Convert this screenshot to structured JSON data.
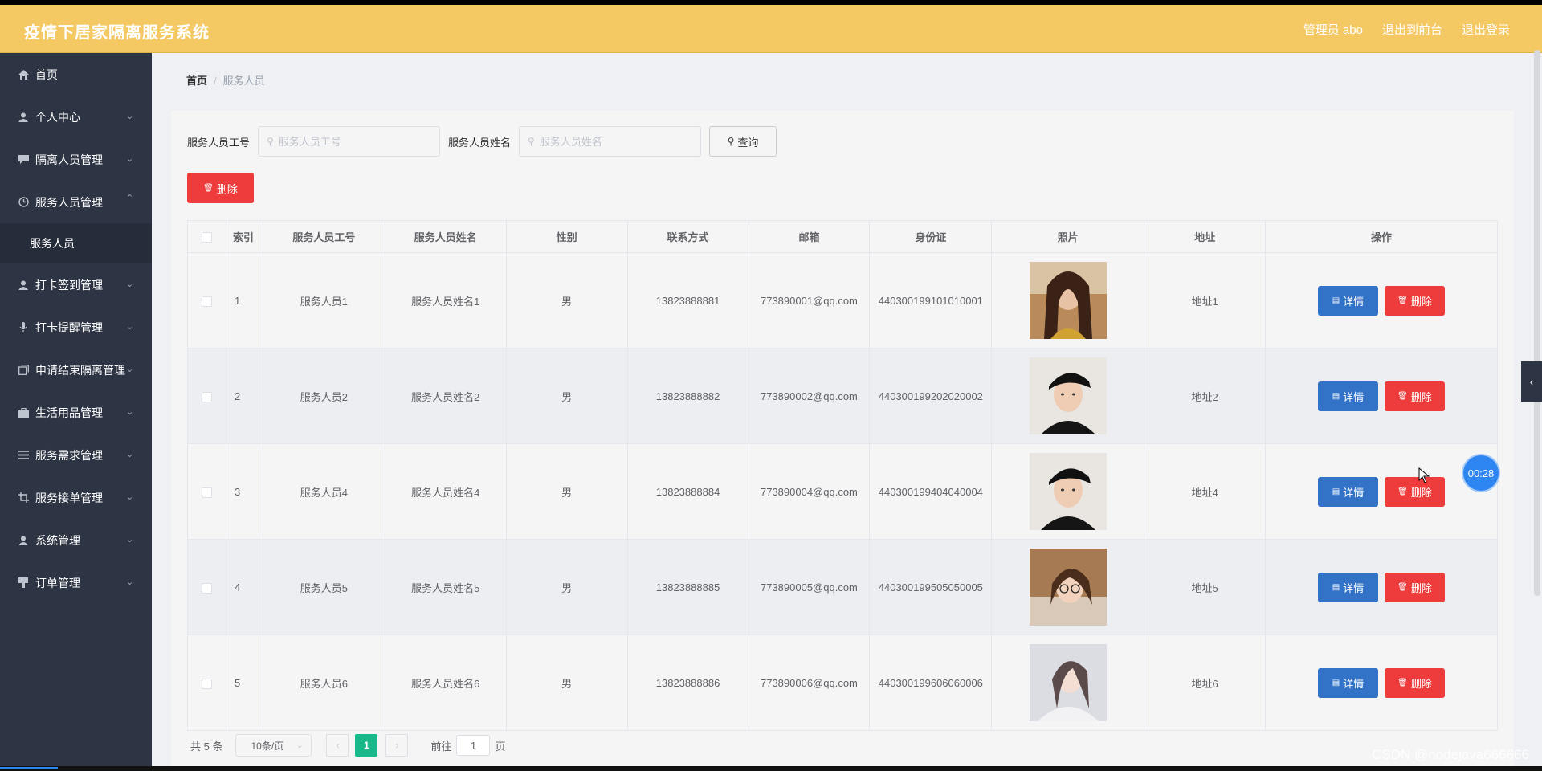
{
  "header": {
    "title": "疫情下居家隔离服务系统",
    "user": "管理员 abo",
    "front": "退出到前台",
    "logout": "退出登录"
  },
  "sidebar": {
    "items": [
      {
        "label": "首页",
        "icon": "home-icon",
        "expandable": false
      },
      {
        "label": "个人中心",
        "icon": "user-icon",
        "expandable": true
      },
      {
        "label": "隔离人员管理",
        "icon": "chat-icon",
        "expandable": true
      },
      {
        "label": "服务人员管理",
        "icon": "clock-icon",
        "expandable": true,
        "expanded": true,
        "sub": "服务人员"
      },
      {
        "label": "打卡签到管理",
        "icon": "user-icon",
        "expandable": true
      },
      {
        "label": "打卡提醒管理",
        "icon": "mic-icon",
        "expandable": true
      },
      {
        "label": "申请结束隔离管理",
        "icon": "copy-icon",
        "expandable": true
      },
      {
        "label": "生活用品管理",
        "icon": "briefcase-icon",
        "expandable": true
      },
      {
        "label": "服务需求管理",
        "icon": "menu-icon",
        "expandable": true
      },
      {
        "label": "服务接单管理",
        "icon": "crop-icon",
        "expandable": true
      },
      {
        "label": "系统管理",
        "icon": "user-icon",
        "expandable": true
      },
      {
        "label": "订单管理",
        "icon": "stamp-icon",
        "expandable": true
      }
    ]
  },
  "breadcrumb": {
    "home": "首页",
    "current": "服务人员"
  },
  "search": {
    "id_label": "服务人员工号",
    "id_placeholder": "服务人员工号",
    "name_label": "服务人员姓名",
    "name_placeholder": "服务人员姓名",
    "query": "查询"
  },
  "toolbar": {
    "delete": "删除"
  },
  "table": {
    "headers": [
      "索引",
      "服务人员工号",
      "服务人员姓名",
      "性别",
      "联系方式",
      "邮箱",
      "身份证",
      "照片",
      "地址",
      "操作"
    ],
    "detail_label": "详情",
    "delete_label": "删除",
    "rows": [
      {
        "index": "1",
        "id": "服务人员1",
        "name": "服务人员姓名1",
        "gender": "男",
        "phone": "13823888881",
        "email": "773890001@qq.com",
        "idcard": "440300199101010001",
        "address": "地址1",
        "photo": "portrait-long-hair"
      },
      {
        "index": "2",
        "id": "服务人员2",
        "name": "服务人员姓名2",
        "gender": "男",
        "phone": "13823888882",
        "email": "773890002@qq.com",
        "idcard": "440300199202020002",
        "address": "地址2",
        "photo": "portrait-cap"
      },
      {
        "index": "3",
        "id": "服务人员4",
        "name": "服务人员姓名4",
        "gender": "男",
        "phone": "13823888884",
        "email": "773890004@qq.com",
        "idcard": "440300199404040004",
        "address": "地址4",
        "photo": "portrait-cap"
      },
      {
        "index": "4",
        "id": "服务人员5",
        "name": "服务人员姓名5",
        "gender": "男",
        "phone": "13823888885",
        "email": "773890005@qq.com",
        "idcard": "440300199505050005",
        "address": "地址5",
        "photo": "portrait-glasses"
      },
      {
        "index": "5",
        "id": "服务人员6",
        "name": "服务人员姓名6",
        "gender": "男",
        "phone": "13823888886",
        "email": "773890006@qq.com",
        "idcard": "440300199606060006",
        "address": "地址6",
        "photo": "portrait-light"
      }
    ]
  },
  "pagination": {
    "total": "共 5 条",
    "page_size": "10条/页",
    "current": "1",
    "goto_prefix": "前往",
    "goto_value": "1",
    "goto_suffix": "页"
  },
  "overlay": {
    "timer": "00:28",
    "watermark": "CSDN @nodejava666666"
  },
  "colors": {
    "header": "#f4c862",
    "sidebar": "#2d3544",
    "primary": "#3273c8",
    "danger": "#ee3b3b",
    "pager_active": "#18b88a"
  }
}
